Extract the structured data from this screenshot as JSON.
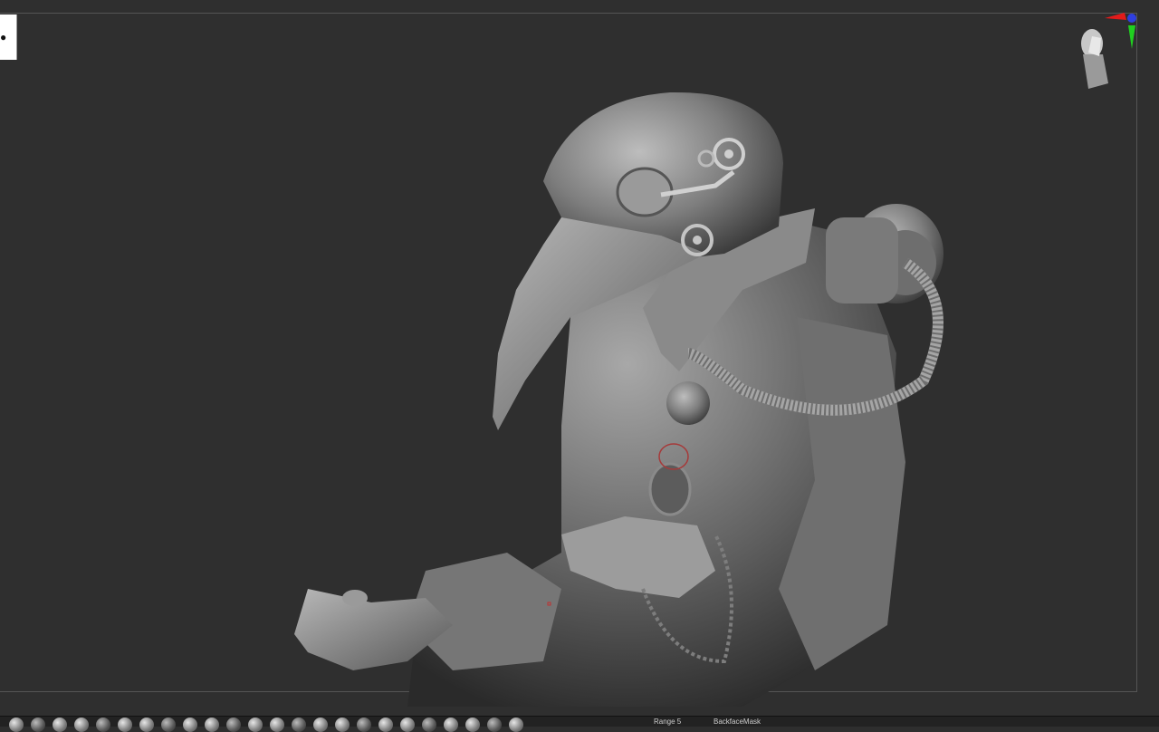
{
  "viewport": {
    "gizmo": {
      "icon": "navigation-cube-icon"
    }
  },
  "model": {
    "icon": "plague-doctor-sculpt"
  },
  "shelf": {
    "tools": [
      "brush-standard-icon",
      "brush-claybuildup-icon",
      "brush-move-icon",
      "brush-dam-standard-icon",
      "brush-inflate-icon",
      "brush-pinch-icon",
      "brush-smooth-icon",
      "brush-trim-icon",
      "brush-polish-icon",
      "brush-hpolish-icon",
      "brush-flatten-icon",
      "brush-snake-hook-icon",
      "brush-clay-icon",
      "brush-clip-icon",
      "brush-slice-icon",
      "brush-mask-icon",
      "brush-curve-icon",
      "brush-insert-icon",
      "brush-zmodeler-icon",
      "brush-selectrect-icon",
      "brush-chisel-icon",
      "brush-imm-icon",
      "brush-matcap-icon",
      "brush-material-icon"
    ],
    "range_label": "Range 5",
    "backface_label": "BackfaceMask"
  }
}
